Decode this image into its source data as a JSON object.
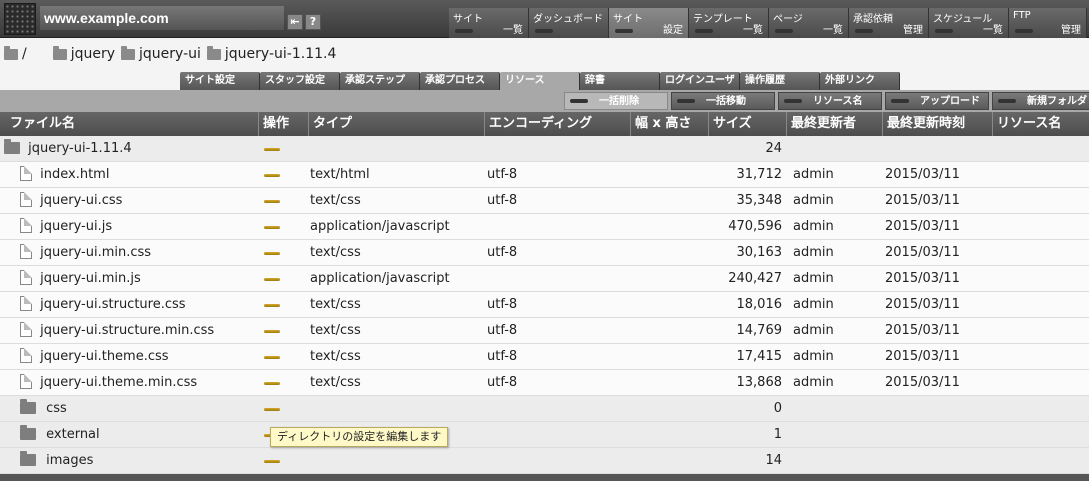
{
  "header": {
    "site_name": "www.example.com",
    "icons": [
      "exit-icon",
      "help-icon"
    ],
    "help_glyph": "?",
    "exit_glyph": "⇤",
    "menus": [
      {
        "title": "サイト",
        "sub": "一覧"
      },
      {
        "title": "ダッシュボード",
        "sub": ""
      },
      {
        "title": "サイト",
        "sub": "設定"
      },
      {
        "title": "テンプレート",
        "sub": "一覧"
      },
      {
        "title": "ページ",
        "sub": "一覧"
      },
      {
        "title": "承認依頼",
        "sub": "管理"
      },
      {
        "title": "スケジュール",
        "sub": "一覧"
      },
      {
        "title": "FTP",
        "sub": "管理"
      }
    ]
  },
  "breadcrumb": {
    "root": "/",
    "items": [
      "jquery",
      "jquery-ui",
      "jquery-ui-1.11.4"
    ]
  },
  "tabs": [
    "サイト設定",
    "スタッフ設定",
    "承認ステップ",
    "承認プロセス",
    "リソース",
    "辞書",
    "ログインユーザ",
    "操作履歴",
    "外部リンク"
  ],
  "actions": [
    "一括削除",
    "一括移動",
    "リソース名",
    "アップロード",
    "新規フォルダ"
  ],
  "table": {
    "headers": [
      "ファイル名",
      "操作",
      "タイプ",
      "エンコーディング",
      "幅 x 高さ",
      "サイズ",
      "最終更新者",
      "最終更新時刻",
      "リソース名"
    ],
    "rows": [
      {
        "kind": "parent",
        "name": "jquery-ui-1.11.4",
        "type": "",
        "enc": "",
        "size": "24",
        "user": "",
        "date": ""
      },
      {
        "kind": "html",
        "name": "index.html",
        "type": "text/html",
        "enc": "utf-8",
        "size": "31,712",
        "user": "admin",
        "date": "2015/03/11"
      },
      {
        "kind": "file",
        "name": "jquery-ui.css",
        "type": "text/css",
        "enc": "utf-8",
        "size": "35,348",
        "user": "admin",
        "date": "2015/03/11"
      },
      {
        "kind": "file",
        "name": "jquery-ui.js",
        "type": "application/javascript",
        "enc": "",
        "size": "470,596",
        "user": "admin",
        "date": "2015/03/11"
      },
      {
        "kind": "file",
        "name": "jquery-ui.min.css",
        "type": "text/css",
        "enc": "utf-8",
        "size": "30,163",
        "user": "admin",
        "date": "2015/03/11"
      },
      {
        "kind": "file",
        "name": "jquery-ui.min.js",
        "type": "application/javascript",
        "enc": "",
        "size": "240,427",
        "user": "admin",
        "date": "2015/03/11"
      },
      {
        "kind": "file",
        "name": "jquery-ui.structure.css",
        "type": "text/css",
        "enc": "utf-8",
        "size": "18,016",
        "user": "admin",
        "date": "2015/03/11"
      },
      {
        "kind": "file",
        "name": "jquery-ui.structure.min.css",
        "type": "text/css",
        "enc": "utf-8",
        "size": "14,769",
        "user": "admin",
        "date": "2015/03/11"
      },
      {
        "kind": "file",
        "name": "jquery-ui.theme.css",
        "type": "text/css",
        "enc": "utf-8",
        "size": "17,415",
        "user": "admin",
        "date": "2015/03/11"
      },
      {
        "kind": "file",
        "name": "jquery-ui.theme.min.css",
        "type": "text/css",
        "enc": "utf-8",
        "size": "13,868",
        "user": "admin",
        "date": "2015/03/11"
      },
      {
        "kind": "dir",
        "name": "css",
        "type": "",
        "enc": "",
        "size": "0",
        "user": "",
        "date": ""
      },
      {
        "kind": "dir",
        "name": "external",
        "type": "",
        "enc": "",
        "size": "1",
        "user": "",
        "date": ""
      },
      {
        "kind": "dir",
        "name": "images",
        "type": "",
        "enc": "",
        "size": "14",
        "user": "",
        "date": ""
      }
    ]
  },
  "tooltip": "ディレクトリの設定を編集します",
  "colors": {
    "accent": "#d6a928",
    "header_bg": "#4d4d4d",
    "tooltip_bg": "#fff9c8"
  }
}
